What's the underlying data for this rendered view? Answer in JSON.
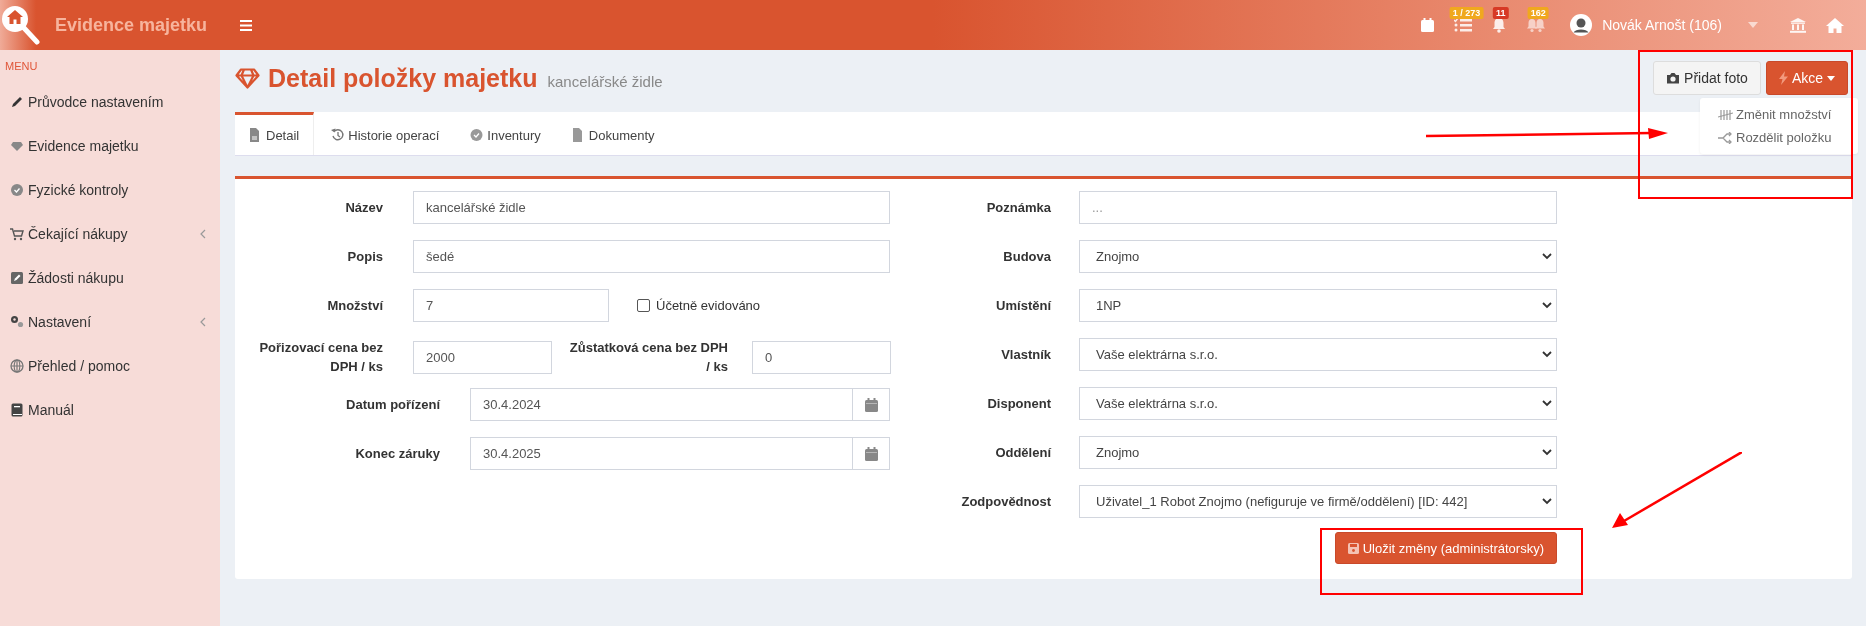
{
  "header": {
    "app_title": "Evidence majetku",
    "notifications": [
      {
        "badge": "1 / 273",
        "color": "#f0a81e"
      },
      {
        "badge": "11",
        "color": "#d73925"
      },
      {
        "badge": "162",
        "color": "#f0a81e"
      }
    ],
    "user_name": "Novák Arnošt (106)"
  },
  "sidebar": {
    "heading": "MENU",
    "items": [
      {
        "label": "Průvodce nastavením",
        "submenu": false
      },
      {
        "label": "Evidence majetku",
        "submenu": false
      },
      {
        "label": "Fyzické kontroly",
        "submenu": false
      },
      {
        "label": "Čekající nákupy",
        "submenu": true
      },
      {
        "label": "Žádosti nákupu",
        "submenu": false
      },
      {
        "label": "Nastavení",
        "submenu": true
      },
      {
        "label": "Přehled / pomoc",
        "submenu": false
      },
      {
        "label": "Manuál",
        "submenu": false
      }
    ]
  },
  "page": {
    "title": "Detail položky majetku",
    "subtitle": "kancelářské židle",
    "buttons": {
      "photo": "Přidat foto",
      "actions": "Akce"
    },
    "actions_menu": [
      "Změnit množství",
      "Rozdělit položku"
    ]
  },
  "tabs": [
    {
      "label": "Detail",
      "selected": true
    },
    {
      "label": "Historie operací",
      "selected": false
    },
    {
      "label": "Inventury",
      "selected": false
    },
    {
      "label": "Dokumenty",
      "selected": false
    }
  ],
  "form": {
    "left": [
      {
        "kind": "text",
        "label": "Název",
        "value": "kancelářské židle"
      },
      {
        "kind": "text",
        "label": "Popis",
        "value": "šedé"
      },
      {
        "kind": "quantity",
        "label": "Množství",
        "value": "7",
        "checkbox": {
          "label": "Účetně evidováno",
          "checked": false
        }
      },
      {
        "kind": "pair",
        "label": "Pořizovací cena bez DPH / ks",
        "value": "2000",
        "label_2": "Zůstatková cena bez DPH / ks",
        "value_2": "0"
      },
      {
        "kind": "date",
        "label": "Datum pořízení",
        "value": "30.4.2024"
      },
      {
        "kind": "date",
        "label": "Konec záruky",
        "value": "30.4.2025"
      }
    ],
    "right": [
      {
        "kind": "text",
        "label": "Poznámka",
        "placeholder": "..."
      },
      {
        "kind": "select",
        "label": "Budova",
        "value": "Znojmo"
      },
      {
        "kind": "select",
        "label": "Umístění",
        "value": "1NP"
      },
      {
        "kind": "select",
        "label": "Vlastník",
        "value": "Vaše elektrárna s.r.o."
      },
      {
        "kind": "select",
        "label": "Disponent",
        "value": "Vaše elektrárna s.r.o."
      },
      {
        "kind": "select",
        "label": "Oddělení",
        "value": "Znojmo"
      },
      {
        "kind": "select",
        "label": "Zodpovědnost",
        "value": "Uživatel_1 Robot Znojmo (nefiguruje ve firmě/oddělení) [ID: 442]"
      }
    ],
    "save_button": "Uložit změny (administrátorsky)"
  },
  "annotations": [
    {
      "kind": "box"
    },
    {
      "kind": "arrow"
    },
    {
      "kind": "box"
    },
    {
      "kind": "arrow"
    }
  ]
}
